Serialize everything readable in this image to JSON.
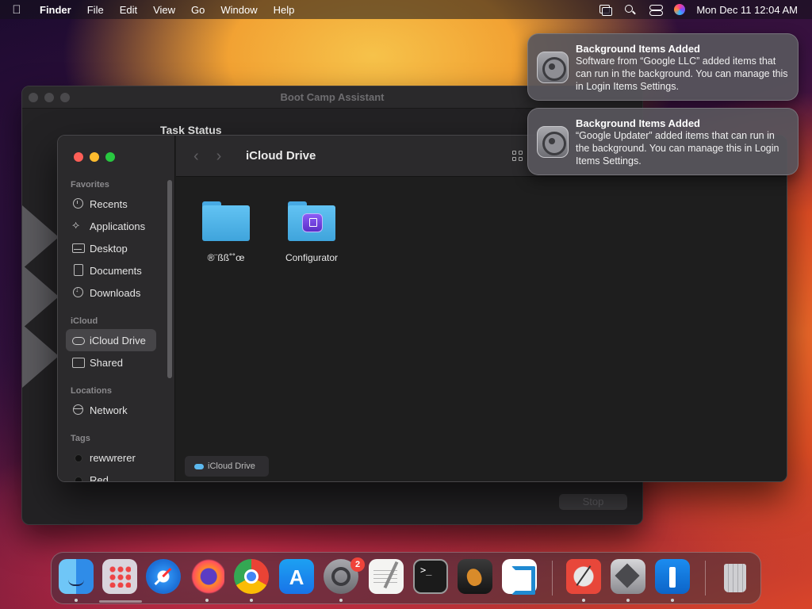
{
  "menubar": {
    "apple_icon": "apple-logo",
    "app_name": "Finder",
    "items": [
      "File",
      "Edit",
      "View",
      "Go",
      "Window",
      "Help"
    ],
    "status_icons": [
      "screen-mirroring-icon",
      "spotlight-search-icon",
      "control-center-icon",
      "siri-icon"
    ],
    "clock": "Mon Dec 11  12:04 AM"
  },
  "bootcamp": {
    "title": "Boot Camp Assistant",
    "task_status": "Task Status",
    "stop_label": "Stop"
  },
  "finder": {
    "title": "iCloud Drive",
    "sidebar": {
      "favorites_header": "Favorites",
      "favorites": [
        {
          "label": "Recents",
          "icon": "clock-icon"
        },
        {
          "label": "Applications",
          "icon": "applications-icon"
        },
        {
          "label": "Desktop",
          "icon": "desktop-icon"
        },
        {
          "label": "Documents",
          "icon": "document-icon"
        },
        {
          "label": "Downloads",
          "icon": "download-icon"
        }
      ],
      "icloud_header": "iCloud",
      "icloud": [
        {
          "label": "iCloud Drive",
          "icon": "cloud-icon",
          "selected": true
        },
        {
          "label": "Shared",
          "icon": "shared-folder-icon"
        }
      ],
      "locations_header": "Locations",
      "locations": [
        {
          "label": "Network",
          "icon": "globe-icon"
        }
      ],
      "tags_header": "Tags",
      "tags": [
        {
          "label": "rewwrerer",
          "color": "#000000"
        },
        {
          "label": "Red",
          "color": "#000000"
        }
      ]
    },
    "files": [
      {
        "name": "®¨ßß˚˚œ",
        "icon": "folder-icon"
      },
      {
        "name": "Configurator",
        "icon": "configurator-folder-icon"
      }
    ],
    "pathbar": "iCloud Drive"
  },
  "notifications": [
    {
      "title": "Background Items Added",
      "body": "Software from “Google LLC” added items that can run in the background. You can manage this in Login Items Settings."
    },
    {
      "title": "Background Items Added",
      "body": "“Google Updater” added items that can run in the background. You can manage this in Login Items Settings."
    }
  ],
  "dock": {
    "apps": [
      "Finder",
      "Launchpad",
      "Safari",
      "Firefox",
      "Google Chrome",
      "App Store",
      "System Settings",
      "TextEdit",
      "Terminal",
      "GarageBand",
      "Visual Studio Code",
      "Instruments",
      "Boot Camp Assistant",
      "Keynote",
      "Trash"
    ],
    "settings_badge": "2"
  }
}
